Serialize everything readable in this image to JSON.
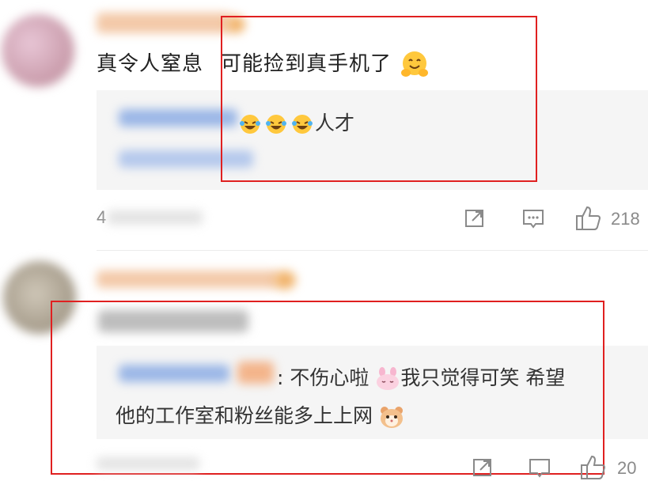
{
  "comment1": {
    "text_before": "真令人窒息",
    "text_after": "可能捡到真手机了",
    "emoji": "hug-emoji",
    "reply": {
      "text": "人才",
      "emoji": "laughing-tears-emoji"
    },
    "time_prefix": "4",
    "likes": "218"
  },
  "comment2": {
    "reply": {
      "text_line1": ": 不伤心啦",
      "text_line1b": "我只觉得可笑 希望",
      "text_line2": "他的工作室和粉丝能多上上网",
      "emoji1": "bunny-emoji",
      "emoji2": "hamster-emoji"
    },
    "likes": "20"
  },
  "colors": {
    "highlight_box": "#e02020",
    "link_blue": "#4a7bd0",
    "quote_bg": "#f5f5f5",
    "icon_gray": "#8a8a8a"
  },
  "icons": [
    "share-icon",
    "comment-icon",
    "like-icon"
  ]
}
